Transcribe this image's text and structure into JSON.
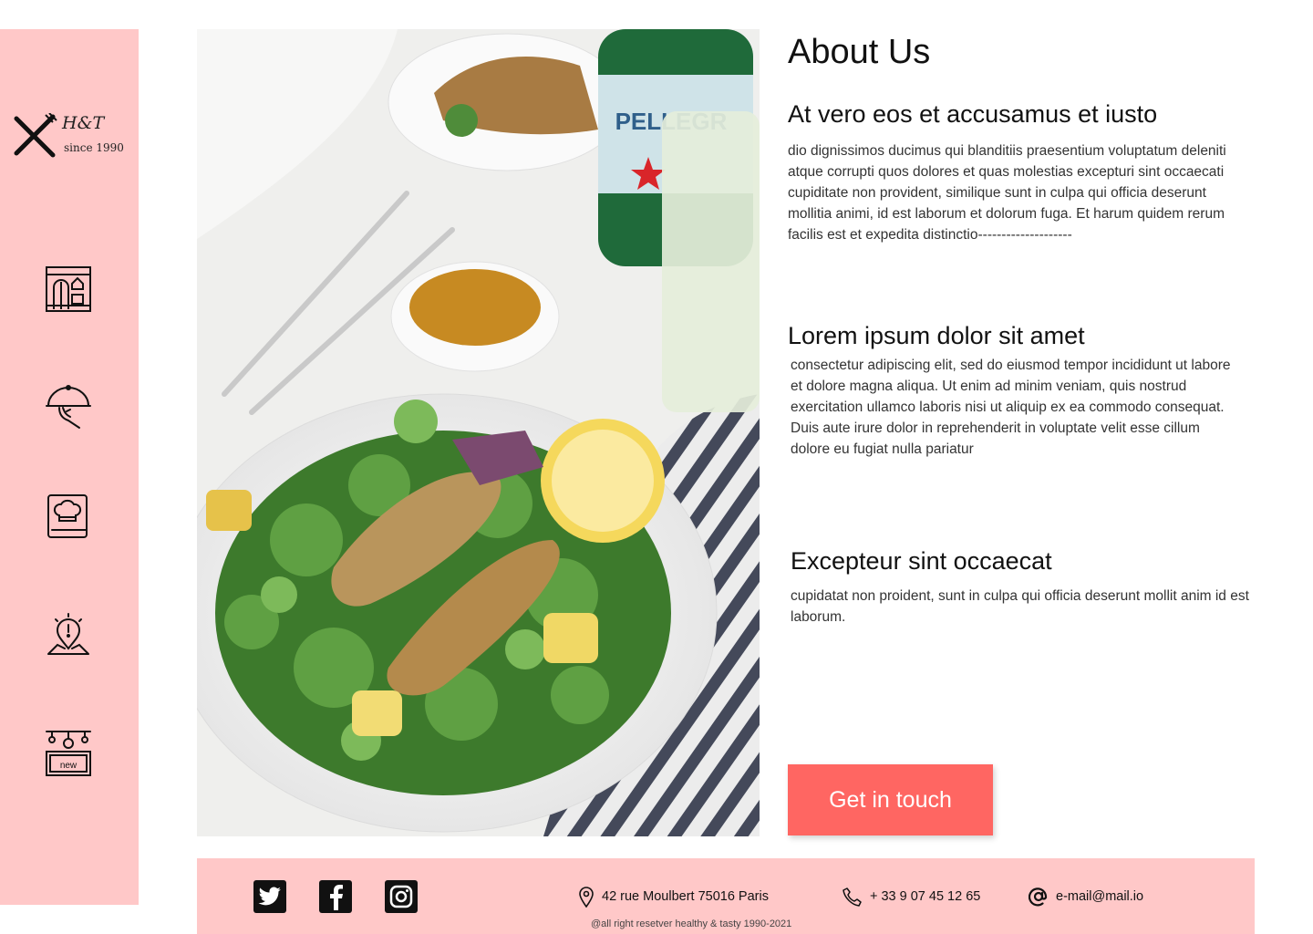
{
  "brand": {
    "name": "H&T",
    "since": "since 1990"
  },
  "sidebar": {
    "items": [
      {
        "icon": "restaurant-storefront-icon"
      },
      {
        "icon": "food-delivery-cloche-icon"
      },
      {
        "icon": "chef-recipe-book-icon"
      },
      {
        "icon": "location-map-alert-icon"
      },
      {
        "icon": "new-dishes-sign-icon"
      }
    ]
  },
  "photo": {
    "alt": "Plate of salad with fried sardines, lemon, sauce bowl and sparkling water bottle"
  },
  "about": {
    "title": "About Us",
    "sections": [
      {
        "heading": "At vero eos et accusamus et iusto",
        "text": "dio dignissimos ducimus qui blanditiis praesentium voluptatum deleniti atque corrupti quos dolores et quas molestias excepturi sint occaecati cupiditate non provident, similique sunt in culpa qui officia deserunt mollitia animi, id est laborum et dolorum fuga. Et harum quidem rerum facilis est et expedita distinctio--------------------"
      },
      {
        "heading": "Lorem ipsum dolor sit amet",
        "text": "consectetur adipiscing elit, sed do eiusmod tempor incididunt ut labore et dolore magna aliqua. Ut enim ad minim veniam, quis nostrud exercitation ullamco laboris nisi ut aliquip ex ea commodo consequat. Duis aute irure dolor in reprehenderit in voluptate velit esse cillum dolore eu fugiat nulla pariatur"
      },
      {
        "heading": "Excepteur sint occaecat",
        "text": "cupidatat non proident, sunt in culpa qui officia deserunt mollit anim id est laborum."
      }
    ],
    "cta_label": "Get in touch"
  },
  "footer": {
    "social": [
      "twitter-icon",
      "facebook-icon",
      "instagram-icon"
    ],
    "address": "42 rue Moulbert 75016 Paris",
    "phone": "+ 33 9 07 45 12 65",
    "email": "e-mail@mail.io",
    "copyright": "@all right resetver  healthy & tasty 1990-2021"
  },
  "colors": {
    "sidebar_bg": "#ffc8c8",
    "footer_bg": "#ffc8c8",
    "accent": "#ff6662"
  }
}
